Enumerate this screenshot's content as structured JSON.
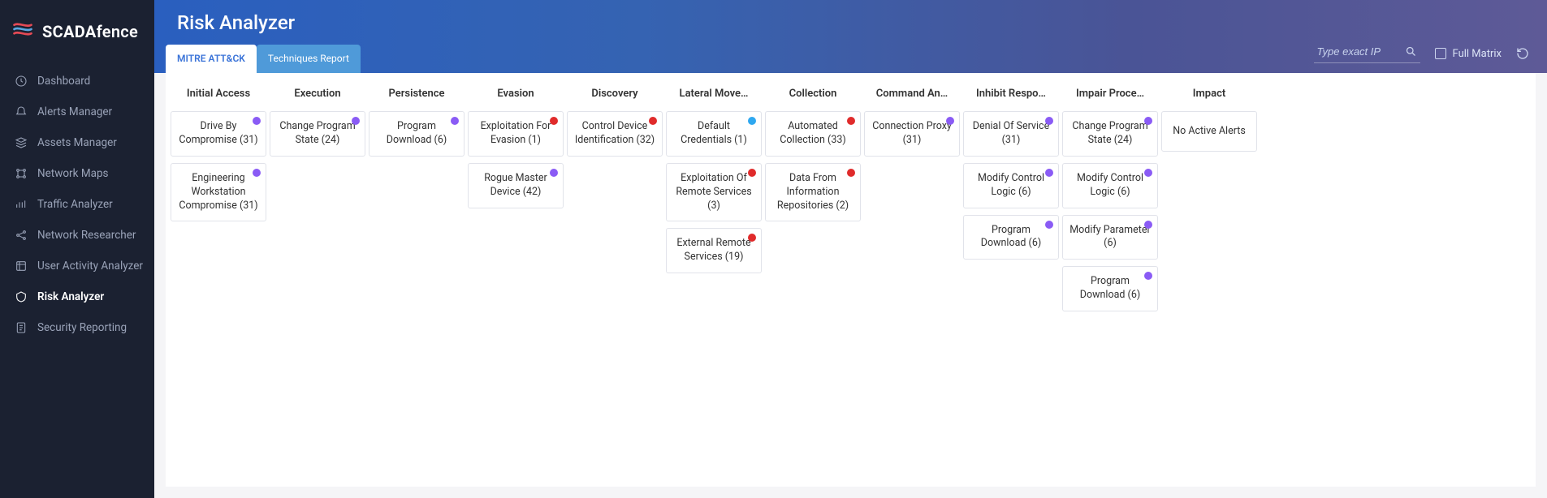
{
  "brand": {
    "name_bold": "SCADA",
    "name_rest": "fence"
  },
  "sidebar": {
    "items": [
      {
        "label": "Dashboard",
        "active": false
      },
      {
        "label": "Alerts Manager",
        "active": false
      },
      {
        "label": "Assets Manager",
        "active": false
      },
      {
        "label": "Network Maps",
        "active": false
      },
      {
        "label": "Traffic Analyzer",
        "active": false
      },
      {
        "label": "Network Researcher",
        "active": false
      },
      {
        "label": "User Activity Analyzer",
        "active": false
      },
      {
        "label": "Risk Analyzer",
        "active": true
      },
      {
        "label": "Security Reporting",
        "active": false
      }
    ]
  },
  "header": {
    "title": "Risk Analyzer",
    "tabs": [
      {
        "label": "MITRE ATT&CK",
        "active": true
      },
      {
        "label": "Techniques Report",
        "active": false
      }
    ],
    "search_placeholder": "Type exact IP",
    "full_matrix_label": "Full Matrix"
  },
  "matrix": {
    "columns": [
      {
        "header": "Initial Access",
        "cards": [
          {
            "label": "Drive By Compromise (31)",
            "dot": "purple"
          },
          {
            "label": "Engineering Workstation Compromise (31)",
            "dot": "purple"
          }
        ]
      },
      {
        "header": "Execution",
        "cards": [
          {
            "label": "Change Program State (24)",
            "dot": "purple"
          }
        ]
      },
      {
        "header": "Persistence",
        "cards": [
          {
            "label": "Program Download (6)",
            "dot": "purple"
          }
        ]
      },
      {
        "header": "Evasion",
        "cards": [
          {
            "label": "Exploitation For Evasion (1)",
            "dot": "red"
          },
          {
            "label": "Rogue Master Device (42)",
            "dot": "purple"
          }
        ]
      },
      {
        "header": "Discovery",
        "cards": [
          {
            "label": "Control Device Identification (32)",
            "dot": "red"
          }
        ]
      },
      {
        "header": "Lateral Move…",
        "cards": [
          {
            "label": "Default Credentials (1)",
            "dot": "blue"
          },
          {
            "label": "Exploitation Of Remote Services (3)",
            "dot": "red"
          },
          {
            "label": "External Remote Services (19)",
            "dot": "red"
          }
        ]
      },
      {
        "header": "Collection",
        "cards": [
          {
            "label": "Automated Collection (33)",
            "dot": "red"
          },
          {
            "label": "Data From Information Repositories (2)",
            "dot": "red"
          }
        ]
      },
      {
        "header": "Command An…",
        "cards": [
          {
            "label": "Connection Proxy (31)",
            "dot": "purple"
          }
        ]
      },
      {
        "header": "Inhibit Respo…",
        "cards": [
          {
            "label": "Denial Of Service (31)",
            "dot": "purple"
          },
          {
            "label": "Modify Control Logic (6)",
            "dot": "purple"
          },
          {
            "label": "Program Download (6)",
            "dot": "purple"
          }
        ]
      },
      {
        "header": "Impair Proce…",
        "cards": [
          {
            "label": "Change Program State (24)",
            "dot": "purple"
          },
          {
            "label": "Modify Control Logic (6)",
            "dot": "purple"
          },
          {
            "label": "Modify Parameter (6)",
            "dot": "purple"
          },
          {
            "label": "Program Download (6)",
            "dot": "purple"
          }
        ]
      },
      {
        "header": "Impact",
        "cards": [
          {
            "label": "No Active Alerts",
            "dot": null
          }
        ]
      }
    ]
  }
}
